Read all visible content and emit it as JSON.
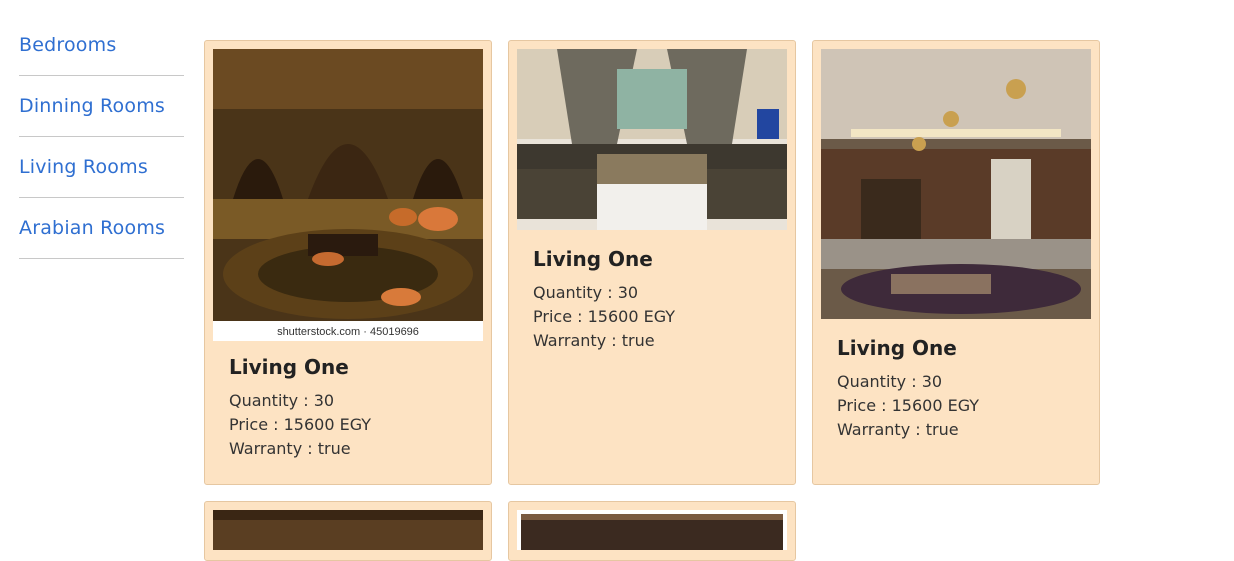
{
  "sidebar": {
    "items": [
      {
        "label": "Bedrooms"
      },
      {
        "label": "Dinning Rooms"
      },
      {
        "label": "Living Rooms"
      },
      {
        "label": "Arabian Rooms"
      }
    ]
  },
  "products": [
    {
      "title": "Living One",
      "quantity_text": "Quantity : 30",
      "price_text": "Price : 15600 EGY",
      "warranty_text": "Warranty : true",
      "image_caption": "shutterstock.com · 45019696"
    },
    {
      "title": "Living One",
      "quantity_text": "Quantity : 30",
      "price_text": "Price : 15600 EGY",
      "warranty_text": "Warranty : true"
    },
    {
      "title": "Living One",
      "quantity_text": "Quantity : 30",
      "price_text": "Price : 15600 EGY",
      "warranty_text": "Warranty : true"
    }
  ],
  "colors": {
    "card_background": "#fde3c3",
    "link": "#2f6fd1"
  }
}
